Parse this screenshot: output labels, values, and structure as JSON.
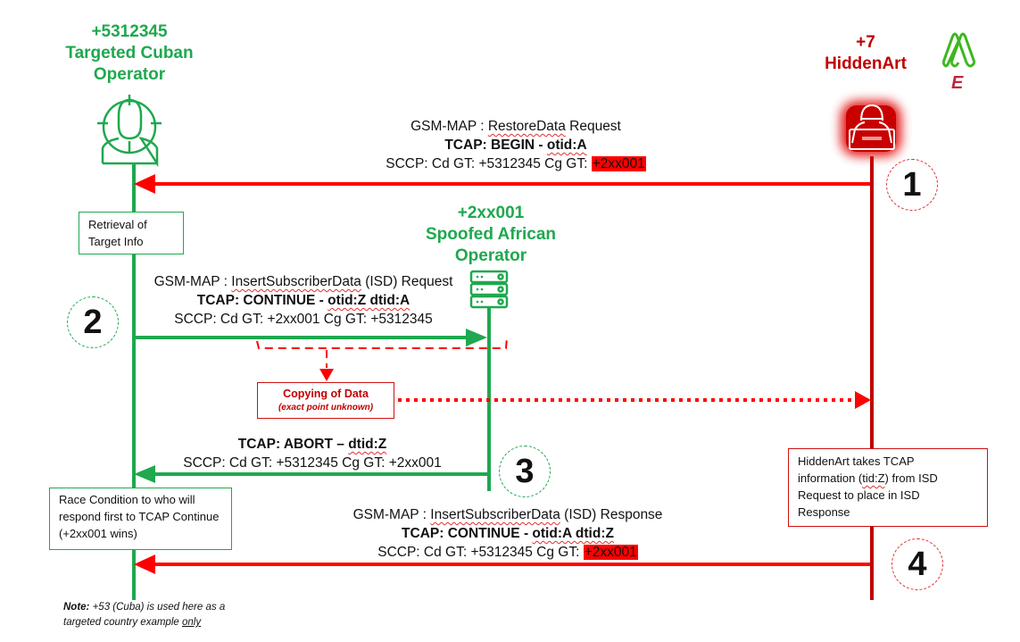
{
  "colors": {
    "green": "#1fa84f",
    "red": "#ff0000",
    "dark_red": "#c00000",
    "highlight": "#ff0000"
  },
  "actors": {
    "target": {
      "number": "+5312345",
      "name_line1": "Targeted Cuban",
      "name_line2": "Operator",
      "icon": "targeted-person-icon"
    },
    "attacker": {
      "number": "+7",
      "name": "HiddenArt",
      "icon": "hacker-laptop-icon"
    },
    "spoofed": {
      "number": "+2xx001",
      "name_line1": "Spoofed African",
      "name_line2": "Operator",
      "icon": "server-stack-icon"
    }
  },
  "logo": {
    "icon": "company-logo-icon",
    "letter": "E"
  },
  "messages": [
    {
      "step": "1",
      "direction": "attacker-to-target",
      "gsm_map_prefix": "GSM-MAP : ",
      "gsm_map_op": "RestoreData",
      "gsm_map_suffix": " Request",
      "tcap_prefix": "TCAP: BEGIN - ",
      "tcap_ids": "otid:A",
      "sccp_prefix": "SCCP: Cd GT: +5312345 Cg GT: ",
      "sccp_highlight": "+2xx001"
    },
    {
      "step": "2",
      "direction": "target-to-spoofed",
      "gsm_map_prefix": "GSM-MAP : ",
      "gsm_map_op": "InsertSubscriberData",
      "gsm_map_suffix": " (ISD) Request",
      "tcap_prefix": "TCAP: CONTINUE - ",
      "tcap_ids": "otid:Z dtid:A",
      "sccp": "SCCP: Cd GT: +2xx001 Cg GT: +5312345"
    },
    {
      "step": "3",
      "direction": "spoofed-to-target",
      "tcap_prefix": "TCAP: ABORT – ",
      "tcap_ids": "dtid:Z",
      "sccp": "SCCP: Cd GT: +5312345 Cg GT: +2xx001"
    },
    {
      "step": "4",
      "direction": "attacker-to-target",
      "gsm_map_prefix": "GSM-MAP : ",
      "gsm_map_op": "InsertSubscriberData",
      "gsm_map_suffix": " (ISD) Response",
      "tcap_prefix": "TCAP: CONTINUE - ",
      "tcap_ids": "otid:A dtid:Z",
      "sccp_prefix": "SCCP: Cd GT: +5312345 Cg GT: ",
      "sccp_highlight": "+2xx001"
    }
  ],
  "notes": {
    "retrieval": "Retrieval of Target Info",
    "race_condition": "Race Condition to who will respond first to TCAP Continue (+2xx001 wins)",
    "hiddenart_prefix": "HiddenArt takes TCAP information (",
    "hiddenart_tid": "tid:Z",
    "hiddenart_suffix": ") from ISD Request to place in ISD Response",
    "copying_title": "Copying of Data",
    "copying_sub": "(exact point unknown)"
  },
  "steps": [
    "1",
    "2",
    "3",
    "4"
  ],
  "footnote": {
    "label": "Note:",
    "text": " +53 (Cuba) is used here as a targeted country example ",
    "emphasis": "only"
  }
}
